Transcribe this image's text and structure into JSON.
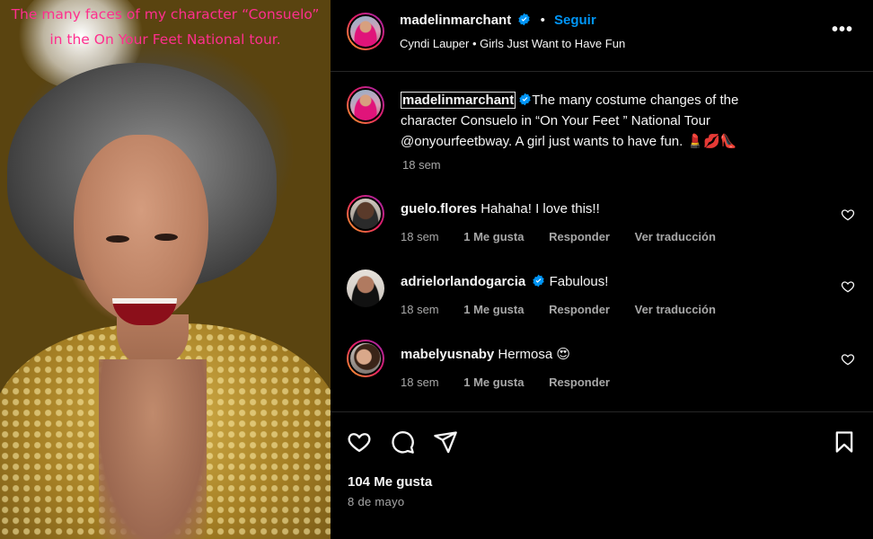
{
  "media": {
    "overlay_line1": "The many faces of my character “Consuelo”",
    "overlay_line2": "in the On Your Feet National tour."
  },
  "header": {
    "username": "madelinmarchant",
    "follow_label": "Seguir",
    "separator": "•",
    "audio": "Cyndi Lauper • Girls Just Want to Have Fun",
    "more_label": "•••"
  },
  "post": {
    "username": "madelinmarchant",
    "caption": "The many costume changes of the character Consuelo in “On Your Feet ” National Tour @onyourfeetbway. A girl just wants to have fun. 💄💋👠",
    "time": "18 sem"
  },
  "comments": [
    {
      "username": "guelo.flores",
      "text": "Hahaha! I love this!!",
      "time": "18 sem",
      "likes": "1 Me gusta",
      "reply": "Responder",
      "translate": "Ver traducción",
      "verified": false
    },
    {
      "username": "adrielorlandogarcia",
      "text": "Fabulous!",
      "time": "18 sem",
      "likes": "1 Me gusta",
      "reply": "Responder",
      "translate": "Ver traducción",
      "verified": true
    },
    {
      "username": "mabelyusnaby",
      "text": "Hermosa 😍",
      "time": "18 sem",
      "likes": "1 Me gusta",
      "reply": "Responder",
      "translate": "",
      "verified": false
    }
  ],
  "footer": {
    "likes": "104 Me gusta",
    "date": "8 de mayo"
  },
  "colors": {
    "background": "#000000",
    "text": "#f5f5f5",
    "muted": "#a8a8a8",
    "link_blue": "#0095f6",
    "verified_blue": "#0095f6",
    "overlay_pink": "#ff2f8e"
  },
  "icons": [
    "verified-badge-icon",
    "more-options-icon",
    "heart-icon",
    "comment-icon",
    "share-icon",
    "bookmark-icon"
  ]
}
